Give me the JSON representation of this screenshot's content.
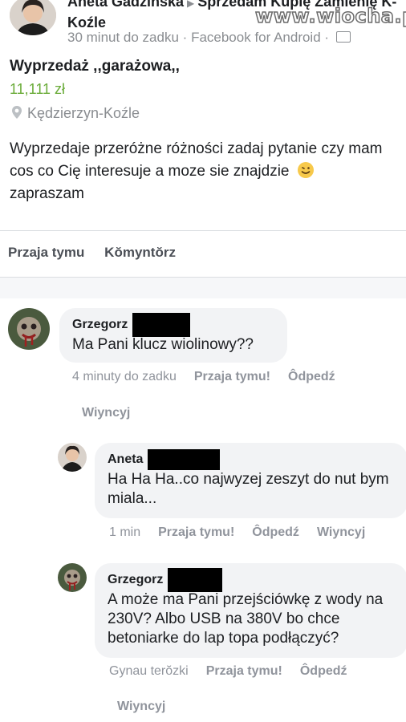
{
  "watermark": "www.wiocha.pl",
  "post": {
    "author": "Aneta Gadzinska",
    "group": "Sprzedam Kupię Zamienię K-Koźle",
    "time": "30 minut do zadku",
    "source": "Facebook for Android",
    "separator": "·"
  },
  "listing": {
    "title": "Wyprzedaż ,,garażowa,,",
    "price": "11,111 zł",
    "location": "Kędzierzyn-Koźle",
    "description": "Wyprzedaje przeróżne różności zadaj pytanie czy mam cos co Cię interesuje a moze sie znajdzie",
    "description_end": "zapraszam"
  },
  "post_actions": {
    "like": "Przaja tymu",
    "comment": "Kŏmyntŏrz"
  },
  "comments": [
    {
      "name": "Grzegorz",
      "text": "Ma Pani klucz wiolinowy??",
      "time": "4 minuty do zadku",
      "like": "Przaja tymu!",
      "reply": "Ôdpedź",
      "more": "Wiyncyj"
    },
    {
      "name": "Aneta",
      "text": "Ha Ha Ha..co najwyzej zeszyt do nut bym miala...",
      "time": "1 min",
      "like": "Przaja tymu!",
      "reply": "Ôdpedź",
      "more": "Wiyncyj"
    },
    {
      "name": "Grzegorz",
      "text": "A może ma Pani przejściówkę z wody na 230V? Albo USB na 380V bo chce betoniarke do lap topa podłączyć?",
      "time": "Gynau terŏzki",
      "like": "Przaja tymu!",
      "reply": "Ôdpedź",
      "more": "Wiyncyj"
    }
  ],
  "colors": {
    "price": "#6bac3a",
    "bubble": "#f2f3f5",
    "meta": "#90949c"
  }
}
